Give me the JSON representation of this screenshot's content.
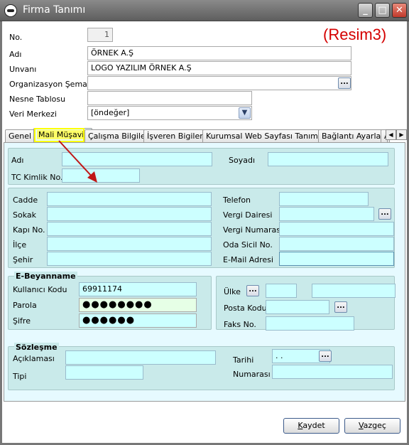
{
  "window": {
    "title": "Firma Tanımı",
    "minimize": "_",
    "maximize": "□",
    "close": "✕"
  },
  "annotation": "(Resim3)",
  "header": {
    "no_label": "No.",
    "no_value": "1",
    "adi_label": "Adı",
    "adi_value": "ÖRNEK A.Ş",
    "unvani_label": "Unvanı",
    "unvani_value": "LOGO YAZILIM ÖRNEK A.Ş",
    "org_label": "Organizasyon Şeması",
    "org_value": "",
    "nesne_label": "Nesne Tablosu",
    "nesne_value": "",
    "veri_label": "Veri Merkezi",
    "veri_value": "[öndeğer]"
  },
  "tabs": [
    {
      "label": "Genel"
    },
    {
      "label": "Mali Müşavir"
    },
    {
      "label": "Çalışma Bilgileri"
    },
    {
      "label": "İşveren Bigileri"
    },
    {
      "label": "Kurumsal Web Sayfası Tanımları"
    },
    {
      "label": "Bağlantı Ayarları"
    },
    {
      "label": "Ay"
    }
  ],
  "person": {
    "adi_label": "Adı",
    "soyadi_label": "Soyadı",
    "tc_label": "TC Kimlik No."
  },
  "address": {
    "cadde": "Cadde",
    "sokak": "Sokak",
    "kapi": "Kapı No.",
    "ilce": "İlçe",
    "sehir": "Şehir",
    "telefon": "Telefon",
    "vergi_dairesi": "Vergi Dairesi",
    "vergi_no": "Vergi Numarası",
    "oda_sicil": "Oda Sicil No.",
    "email": "E-Mail Adresi"
  },
  "ebeyan": {
    "title": "E-Beyanname",
    "kullanici_label": "Kullanıcı Kodu",
    "kullanici_value": "69911174",
    "parola_label": "Parola",
    "parola_value": "●●●●●●●●",
    "sifre_label": "Şifre",
    "sifre_value": "●●●●●●"
  },
  "location": {
    "ulke_label": "Ülke",
    "posta_label": "Posta Kodu",
    "faks_label": "Faks No."
  },
  "sozlesme": {
    "title": "Sözleşme",
    "aciklama_label": "Açıklaması",
    "tipi_label": "Tipi",
    "tarihi_label": "Tarihi",
    "tarihi_value": ".  .",
    "numarasi_label": "Numarası"
  },
  "buttons": {
    "kaydet_u": "K",
    "kaydet_rest": "aydet",
    "vazgec_u": "V",
    "vazgec_rest": "azgeç"
  },
  "colors": {
    "field_cyan": "#ccffff",
    "group_bg": "#c9eaea",
    "annotation_red": "#d40000",
    "highlight": "#ffff00"
  }
}
